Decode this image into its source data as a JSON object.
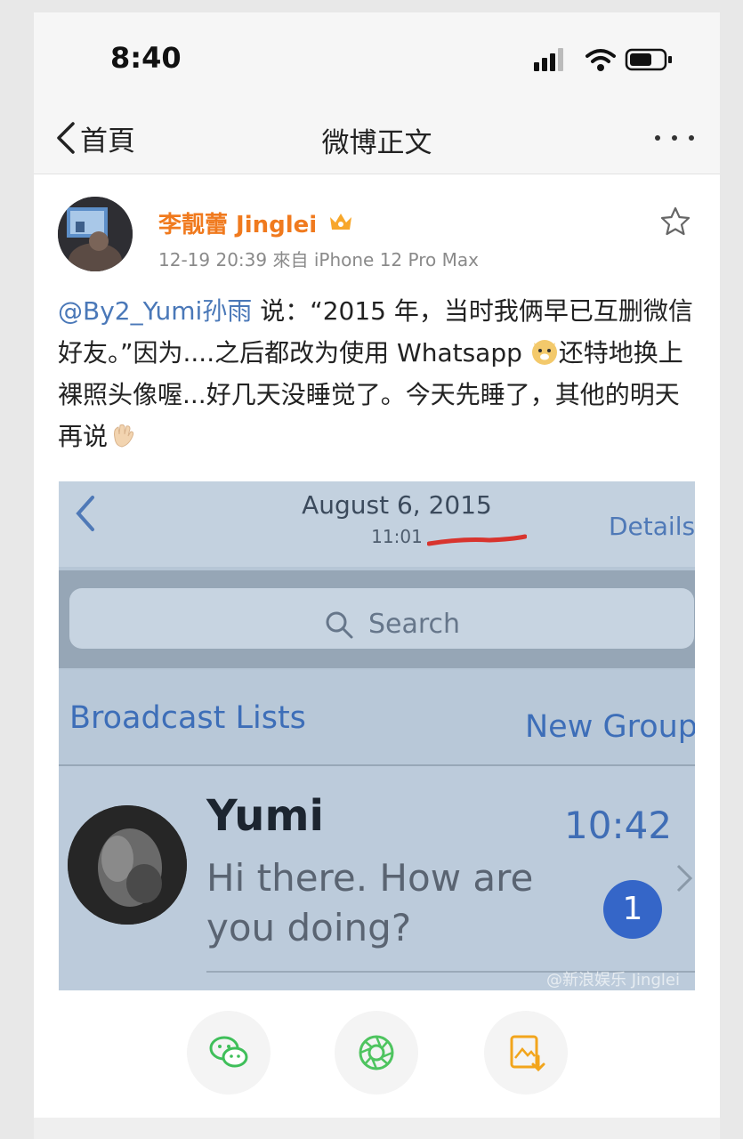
{
  "status_bar": {
    "time": "8:40"
  },
  "nav": {
    "back_label": "首頁",
    "title": "微博正文"
  },
  "post": {
    "author": "李靓蕾 Jinglei",
    "meta": "12-19 20:39  來自 iPhone 12 Pro Max",
    "mention": "@By2_Yumi孙雨",
    "text_part1": " 说：“2015 年，当时我俩早已互删微信好友。”因为....之后都改为使用 Whatsapp",
    "text_part2": "还特地换上裸照头像喔...好几天没睡觉了。今天先睡了，其他的明天再说"
  },
  "photo": {
    "date": "August 6, 2015",
    "time": "11:01",
    "details": "Details",
    "search_placeholder": "Search",
    "broadcast": "Broadcast Lists",
    "new_group": "New Group",
    "chat_name": "Yumi",
    "chat_time": "10:42",
    "chat_message": "Hi there. How are you doing?",
    "unread_count": "1",
    "watermark": "@新浪娱乐 Jinglei"
  },
  "actions": {
    "items": [
      "wechat-share-icon",
      "moments-share-icon",
      "save-image-icon"
    ]
  },
  "colors": {
    "author": "#f07a1e",
    "mention": "#4a78b8",
    "whatsapp_link": "#3d6eb8",
    "badge": "#3566c8"
  }
}
